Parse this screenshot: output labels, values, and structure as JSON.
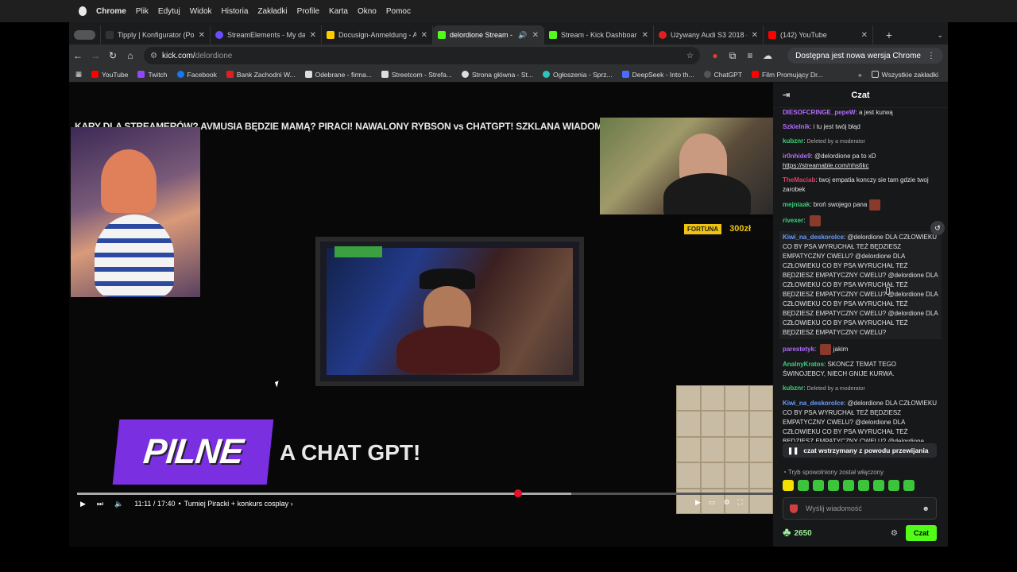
{
  "menubar": {
    "app": "Chrome",
    "items": [
      "Plik",
      "Edytuj",
      "Widok",
      "Historia",
      "Zakładki",
      "Profile",
      "Karta",
      "Okno",
      "Pomoc"
    ]
  },
  "tabs": [
    {
      "label": "Tipply | Konfigurator (Po...",
      "color": "#333"
    },
    {
      "label": "StreamElements - My das...",
      "color": "#6b4cff"
    },
    {
      "label": "Docusign-Anmeldung - A...",
      "color": "#ffcc00"
    },
    {
      "label": "delordione Stream - ...",
      "color": "#53fc18",
      "active": true
    },
    {
      "label": "Stream - Kick Dashboard",
      "color": "#53fc18"
    },
    {
      "label": "Używany Audi S3 2018 -...",
      "color": "#e02020"
    },
    {
      "label": "(142) YouTube",
      "color": "#ff0000"
    }
  ],
  "address": {
    "domain": "kick.com/",
    "path": "delordione"
  },
  "update_label": "Dostępna jest nowa wersja Chrome",
  "bookmarks": [
    {
      "label": "YouTube",
      "color": "#ff0000"
    },
    {
      "label": "Twitch",
      "color": "#9146ff"
    },
    {
      "label": "Facebook",
      "color": "#1877f2"
    },
    {
      "label": "Bank Zachodni W...",
      "color": "#e02020"
    },
    {
      "label": "Odebrane - firma...",
      "color": "#dddddd"
    },
    {
      "label": "Streetcom - Strefa...",
      "color": "#dddddd"
    },
    {
      "label": "Strona główna - St...",
      "color": "#dddddd"
    },
    {
      "label": "Ogłoszenia - Sprz...",
      "color": "#2ec4b6"
    },
    {
      "label": "DeepSeek - Into th...",
      "color": "#4d6bfe"
    },
    {
      "label": "ChatGPT",
      "color": "#555555"
    },
    {
      "label": "Film Promujący Dr...",
      "color": "#ff0000"
    }
  ],
  "bookmarks_all": "Wszystkie zakładki",
  "stream": {
    "title": "KARY DLA STREAMERÓW? AVMUSIA BĘDZIE MAMĄ? PIRACI! NAWALONY RYBSON vs CHATGPT! SZKLANA WIADOMO",
    "fortuna_brand": "FORTUNA",
    "fortuna_amount": "300zł",
    "pilne": "PILNE",
    "pilne_sub": "A CHAT GPT!",
    "time": "11:11 / 17:40",
    "chapter": "Turniej Piracki + konkurs cosplay ›",
    "progress": 0.633,
    "buffered": 0.71
  },
  "chat": {
    "title": "Czat",
    "messages": [
      {
        "user": "DIESOFCRINGE_pepeW",
        "color": "#b36bff",
        "text": "a jest kurwą"
      },
      {
        "user": "Szkielnik",
        "color": "#b36bff",
        "text": "i tu jest twój błąd"
      },
      {
        "user": "kubznr",
        "color": "#3ad07a",
        "text": "Deleted by a moderator",
        "mod": true
      },
      {
        "user": "ir0nhide9",
        "color": "#b36bff",
        "text": "@delordione pa to xD",
        "link": "https://streamable.com/nhs6kc"
      },
      {
        "user": "TheMaciab",
        "color": "#e04060",
        "text": "twoj empatia konczy sie tam gdzie twoj zarobek"
      },
      {
        "user": "mejniaak",
        "color": "#3ad07a",
        "text": "broń swojego pana",
        "emote": true
      },
      {
        "user": "rivexer",
        "color": "#3ad07a",
        "text": "",
        "emote": true
      },
      {
        "user": "Kiwi_na_deskorolce",
        "color": "#6a9cff",
        "text": "@delordione DLA CZŁOWIEKU CO BY PSA WYRUCHAŁ TEŻ BĘDZIESZ EMPATYCZNY CWELU? @delordione DLA CZŁOWIEKU CO BY PSA WYRUCHAŁ TEŻ BĘDZIESZ EMPATYCZNY CWELU? @delordione DLA CZŁOWIEKU CO BY PSA WYRUCHAŁ TEŻ BĘDZIESZ EMPATYCZNY CWELU? @delordione DLA CZŁOWIEKU CO BY PSA WYRUCHAŁ TEŻ BĘDZIESZ EMPATYCZNY CWELU? @delordione DLA CZŁOWIEKU CO BY PSA WYRUCHAŁ TEŻ BĘDZIESZ EMPATYCZNY CWELU?",
        "hl": true
      },
      {
        "user": "parestetyk",
        "color": "#b36bff",
        "text": "jakim",
        "emote": true
      },
      {
        "user": "AnalnyKratos",
        "color": "#3ad07a",
        "text": "SKONCZ TEMAT TEGO ŚWINOJEBCY, NIECH GNIJE KURWA."
      },
      {
        "user": "kubznr",
        "color": "#3ad07a",
        "text": "Deleted by a moderator",
        "mod": true
      },
      {
        "user": "Kiwi_na_deskorolce",
        "color": "#6a9cff",
        "text": "@delordione DLA CZŁOWIEKU CO BY PSA WYRUCHAŁ TEŻ BĘDZIESZ EMPATYCZNY CWELU? @delordione DLA CZŁOWIEKU CO BY PSA WYRUCHAŁ TEŻ BĘDZIESZ EMPATYCZNY CWELU? @delordione"
      }
    ],
    "paused_label": "czat wstrzymany z powodu przewijania",
    "slowmode": "Tryb spowolniony został włączony",
    "input_placeholder": "Wyślij wiadomość",
    "points": "2650",
    "send_label": "Czat"
  }
}
